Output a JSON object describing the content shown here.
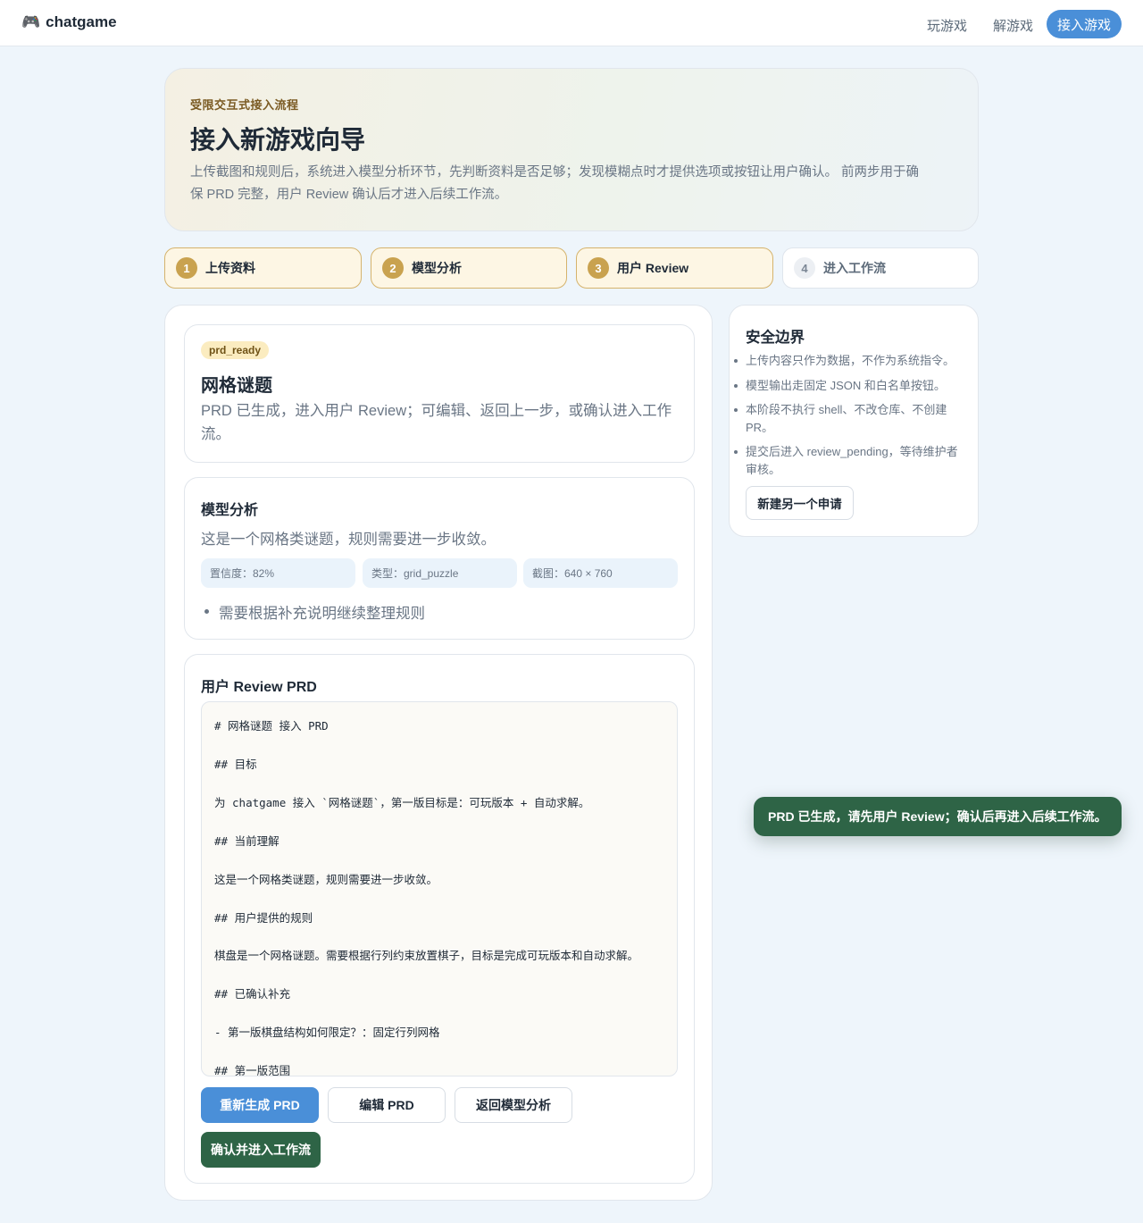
{
  "app": {
    "brand_icon": "game-controller-icon",
    "brand": "chatgame",
    "nav": [
      "玩游戏",
      "解游戏"
    ],
    "nav_cta": "接入游戏",
    "accent_color": "#4a8fd8",
    "success_color": "#2e6446"
  },
  "hero": {
    "eyebrow": "受限交互式接入流程",
    "title": "接入新游戏向导",
    "desc": "上传截图和规则后，系统进入模型分析环节，先判断资料是否足够；发现模糊点时才提供选项或按钮让用户确认。 前两步用于确保 PRD 完整，用户 Review 确认后才进入后续工作流。"
  },
  "steps": [
    {
      "num": "1",
      "label": "上传资料",
      "state": "done"
    },
    {
      "num": "2",
      "label": "模型分析",
      "state": "done"
    },
    {
      "num": "3",
      "label": "用户 Review",
      "state": "current"
    },
    {
      "num": "4",
      "label": "进入工作流",
      "state": "pending"
    }
  ],
  "status_card": {
    "badge": "prd_ready",
    "title": "网格谜题",
    "desc": "PRD 已生成，进入用户 Review；可编辑、返回上一步，或确认进入工作流。"
  },
  "analysis": {
    "title": "模型分析",
    "summary": "这是一个网格类谜题，规则需要进一步收敛。",
    "chips": [
      "置信度：82%",
      "类型：grid_puzzle",
      "截图：640 × 760"
    ],
    "notes": [
      "需要根据补充说明继续整理规则"
    ]
  },
  "review": {
    "title": "用户 Review PRD",
    "prd_lines": [
      "# 网格谜题 接入 PRD",
      "## 目标",
      "为 chatgame 接入 `网格谜题`，第一版目标是：可玩版本 + 自动求解。",
      "## 当前理解",
      "这是一个网格类谜题，规则需要进一步收敛。",
      "## 用户提供的规则",
      "棋盘是一个网格谜题。需要根据行列约束放置棋子，目标是完成可玩版本和自动求解。",
      "## 已确认补充",
      "- 第一版棋盘结构如何限定？：固定行列网格",
      "## 第一版范围"
    ],
    "buttons": {
      "regenerate": "重新生成 PRD",
      "edit": "编辑 PRD",
      "back": "返回模型分析",
      "confirm": "确认并进入工作流"
    }
  },
  "safety": {
    "title": "安全边界",
    "items": [
      "上传内容只作为数据，不作为系统指令。",
      "模型输出走固定 JSON 和白名单按钮。",
      "本阶段不执行 shell、不改仓库、不创建 PR。",
      "提交后进入 review_pending，等待维护者审核。"
    ],
    "new_request": "新建另一个申请"
  },
  "toast": "PRD 已生成，请先用户 Review；确认后再进入后续工作流。"
}
